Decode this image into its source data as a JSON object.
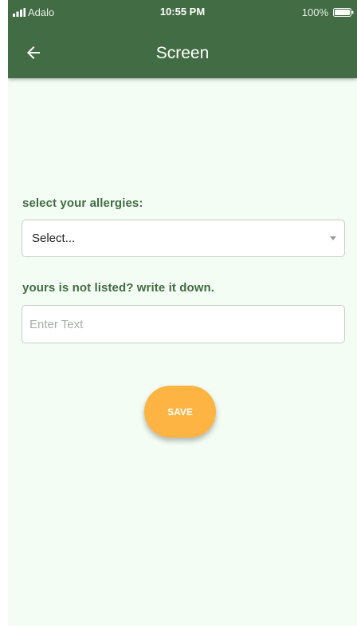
{
  "status_bar": {
    "carrier": "Adalo",
    "time": "10:55 PM",
    "battery": "100%"
  },
  "header": {
    "title": "Screen",
    "back_icon": "arrow-left-icon"
  },
  "form": {
    "allergies_label": "select your allergies:",
    "allergies_select_value": "Select...",
    "not_listed_label": "yours is not listed? write it down.",
    "text_placeholder": "Enter Text",
    "text_value": ""
  },
  "save_button": {
    "label": "SAVE"
  },
  "colors": {
    "header": "#426c43",
    "background": "#f3fdf4",
    "label": "#426c43",
    "accent": "#fdb443"
  }
}
